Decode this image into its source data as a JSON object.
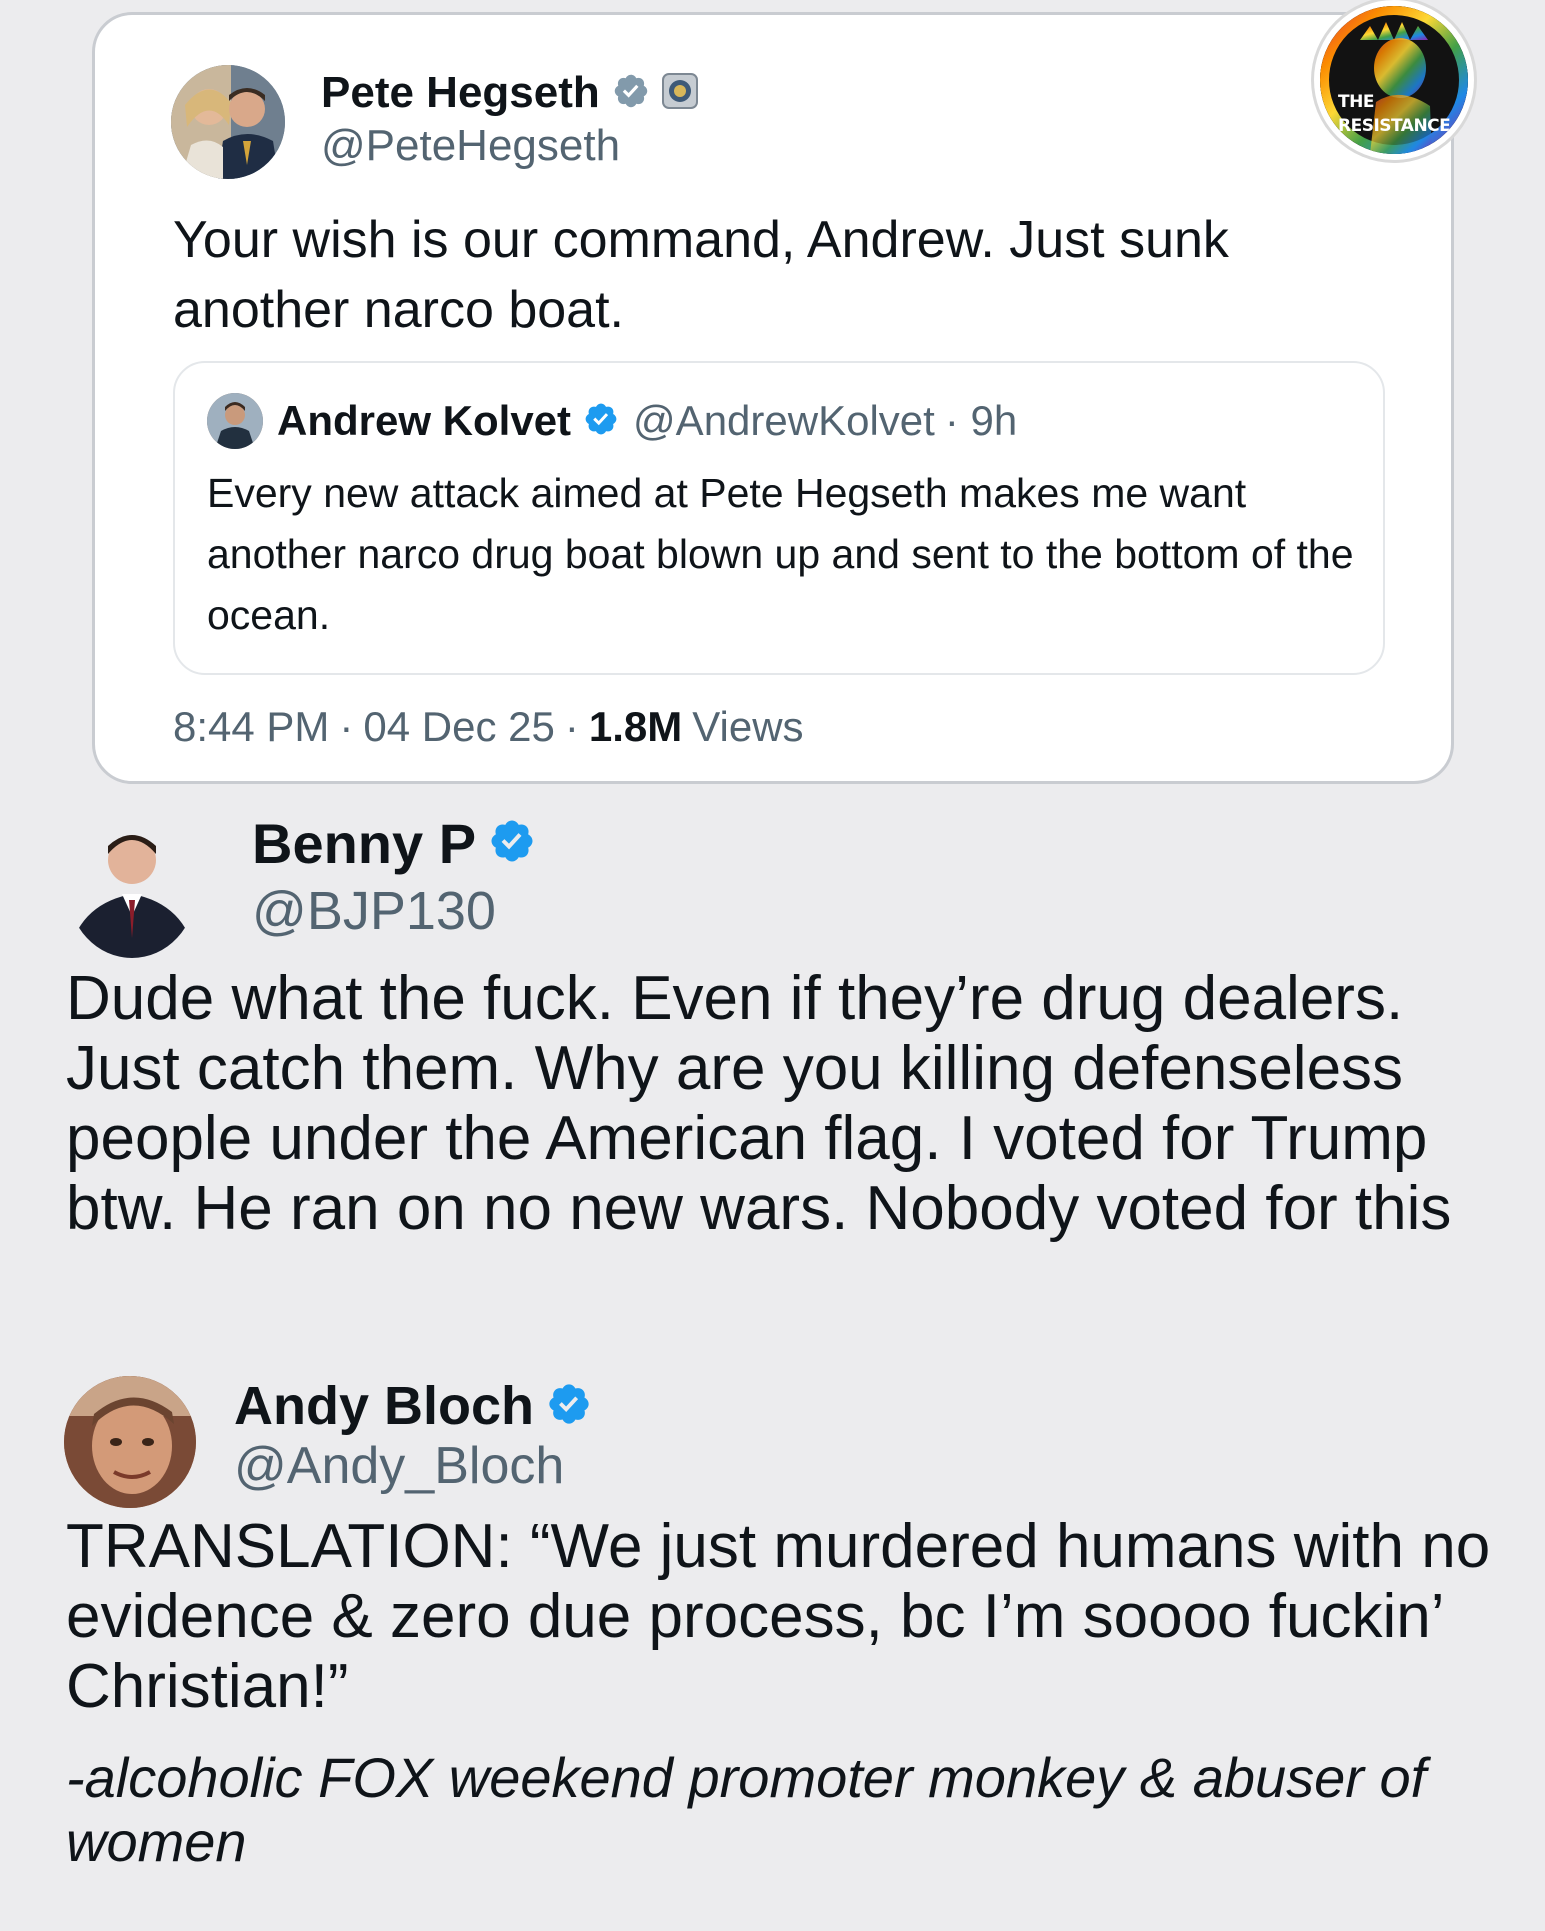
{
  "main_tweet": {
    "author_name": "Pete Hegseth",
    "author_handle": "@PeteHegseth",
    "text": "Your wish is our command, Andrew. Just sunk another narco boat.",
    "time": "8:44 PM",
    "date": "04 Dec 25",
    "views_count": "1.8M",
    "views_label": "Views",
    "separator": "·"
  },
  "quoted_tweet": {
    "author_name": "Andrew Kolvet",
    "author_handle": "@AndrewKolvet",
    "age": "· 9h",
    "text": "Every new attack aimed at Pete Hegseth makes me want another narco drug boat blown up and sent to the bottom of the ocean."
  },
  "logo": {
    "line1": "THE",
    "line2": "RESISTANCE"
  },
  "reply_benny": {
    "author_name": "Benny P",
    "author_handle": "@BJP130",
    "text": "Dude what the fuck. Even if they’re drug dealers. Just catch them. Why are you killing defenseless people under the American flag. I voted for Trump btw. He ran on no new wars. Nobody voted for this"
  },
  "reply_andy": {
    "author_name": "Andy Bloch",
    "author_handle": "@Andy_Bloch",
    "text": "TRANSLATION: “We just murdered humans with no evidence & zero due process, bc I’m soooo fuckin’ Christian!”",
    "caption": "-alcoholic FOX weekend promoter monkey & abuser of women"
  },
  "colors": {
    "verified_blue": "#1d9bf0",
    "secondary_text": "#536471",
    "page_bg": "#ececee"
  },
  "icons": [
    "verified-badge-icon",
    "government-seal-icon",
    "avatar-pete",
    "avatar-andrew",
    "avatar-benny",
    "avatar-andy",
    "resistance-logo"
  ]
}
